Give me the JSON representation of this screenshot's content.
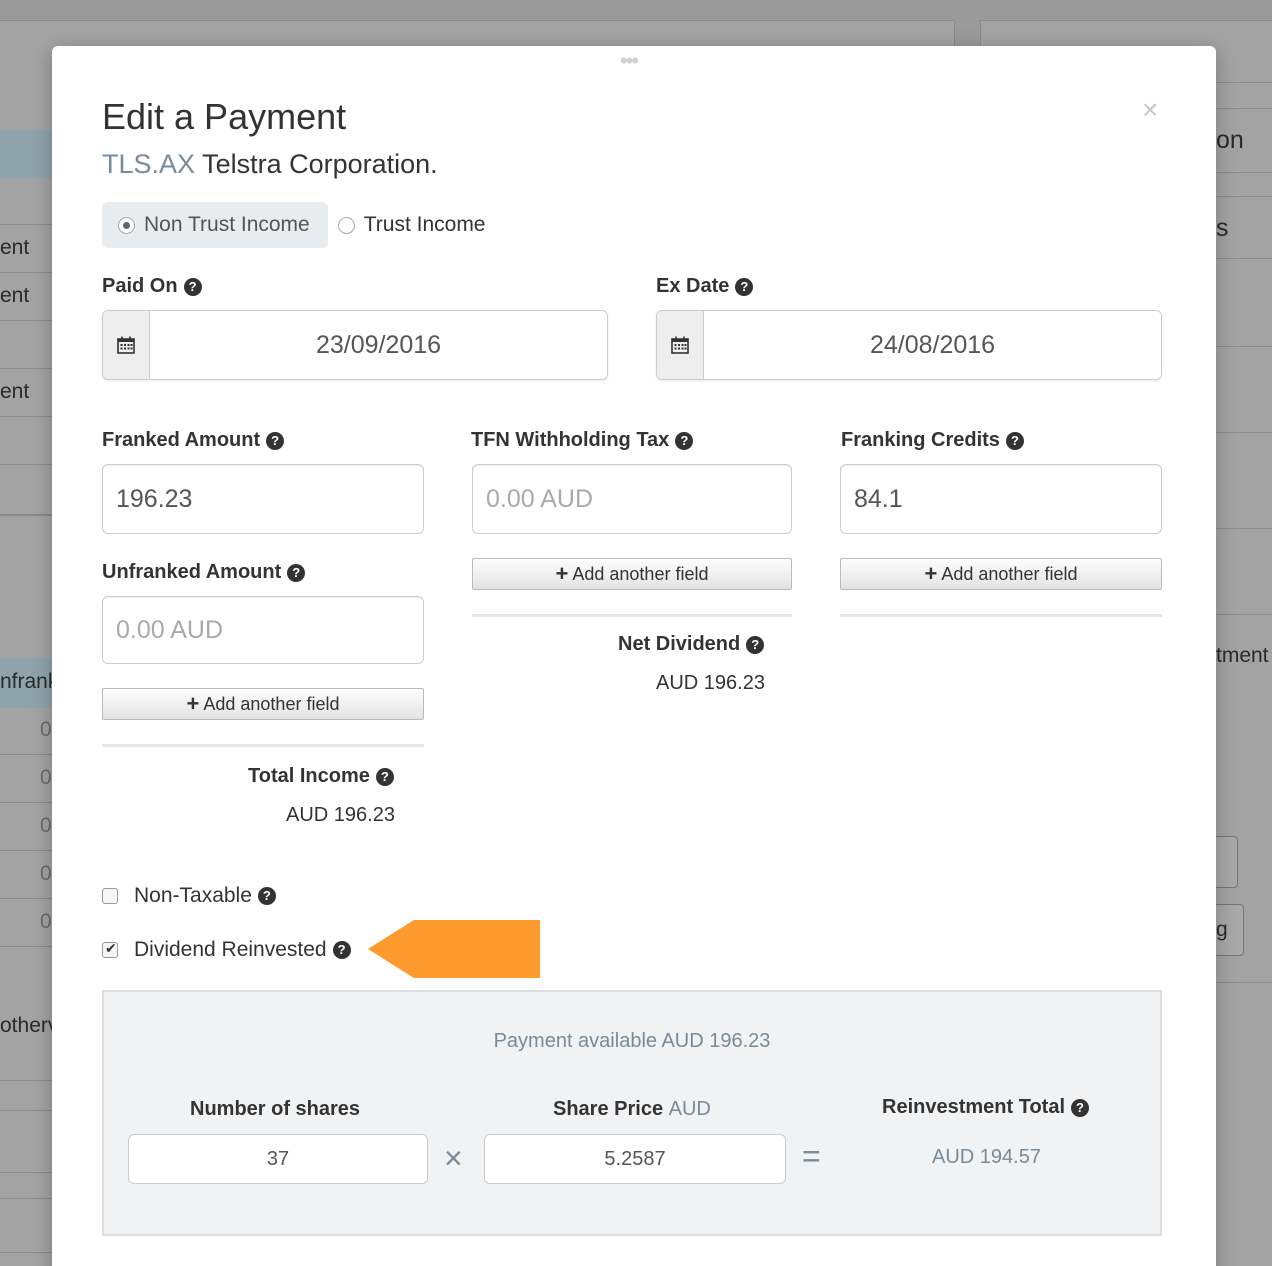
{
  "background": {
    "left_fragments": [
      "ent",
      "ent",
      "ent",
      "nfrank",
      "0",
      "0",
      "0",
      "0",
      "0",
      "otherv"
    ],
    "right_fragments": [
      "on",
      "s",
      "tment",
      "g"
    ]
  },
  "modal": {
    "title": "Edit a Payment",
    "ticker": "TLS.AX",
    "company": "Telstra Corporation.",
    "close_symbol": "×",
    "income_type": {
      "options": [
        "Non Trust Income",
        "Trust Income"
      ],
      "selected": "Non Trust Income"
    },
    "paid_on": {
      "label": "Paid On",
      "value": "23/09/2016"
    },
    "ex_date": {
      "label": "Ex Date",
      "value": "24/08/2016"
    },
    "franked_amount": {
      "label": "Franked Amount",
      "value": "196.23"
    },
    "tfn_withholding": {
      "label": "TFN Withholding Tax",
      "placeholder": "0.00 AUD"
    },
    "franking_credits": {
      "label": "Franking Credits",
      "value": "84.1"
    },
    "unfranked_amount": {
      "label": "Unfranked Amount",
      "placeholder": "0.00 AUD"
    },
    "add_field_label": "Add another field",
    "net_dividend": {
      "label": "Net Dividend",
      "value": "AUD 196.23"
    },
    "total_income": {
      "label": "Total Income",
      "value": "AUD 196.23"
    },
    "non_taxable": {
      "label": "Non-Taxable",
      "checked": false
    },
    "dividend_reinvested": {
      "label": "Dividend Reinvested",
      "checked": true
    },
    "reinvestment": {
      "payment_available": "Payment available AUD 196.23",
      "shares_label": "Number of shares",
      "shares_value": "37",
      "times_symbol": "×",
      "price_label": "Share Price",
      "price_unit": "AUD",
      "price_value": "5.2587",
      "equals_symbol": "=",
      "total_label": "Reinvestment Total",
      "total_value": "AUD 194.57"
    }
  },
  "colors": {
    "accent_arrow": "#ff9a2e",
    "ticker": "#7a8a98"
  },
  "icons": {
    "help": "question-circle-icon",
    "calendar": "calendar-icon",
    "plus": "plus-icon"
  }
}
